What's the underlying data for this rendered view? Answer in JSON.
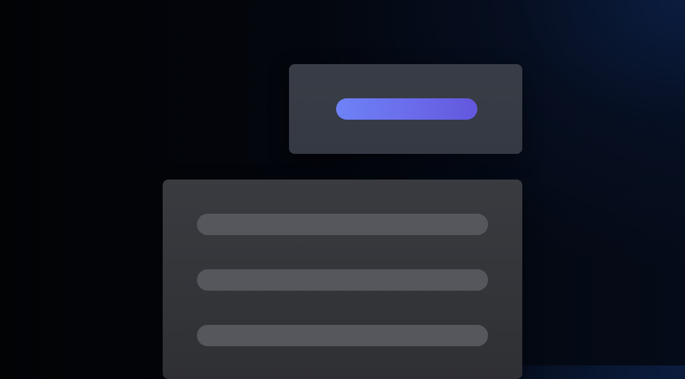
{
  "top_card": {
    "primary_placeholder": {
      "color": "#6a6bea"
    }
  },
  "bottom_card": {
    "lines": [
      {
        "color": "#55575d"
      },
      {
        "color": "#55575d"
      },
      {
        "color": "#55575d"
      }
    ]
  }
}
